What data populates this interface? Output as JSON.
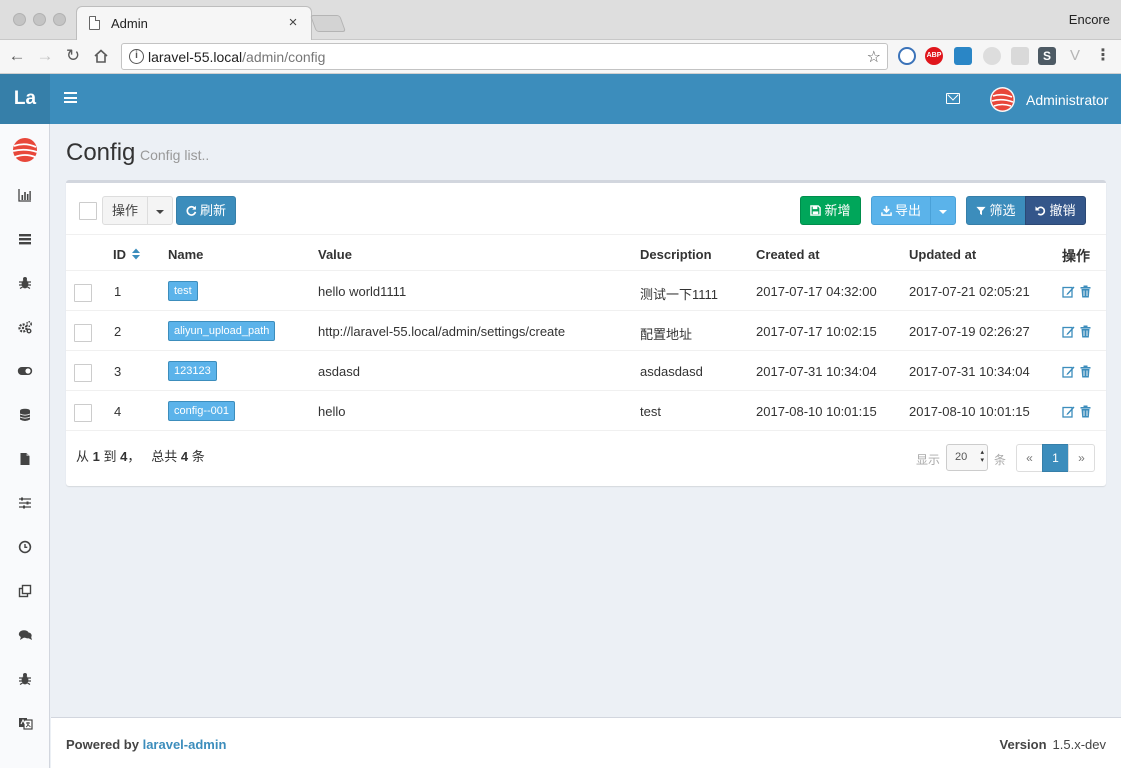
{
  "browser": {
    "tab_title": "Admin",
    "tab_close": "×",
    "profile_name": "Encore",
    "url_host": "laravel-55.local",
    "url_path": "/admin/config",
    "ext_abp": "ABP",
    "ext_s": "S",
    "ext_v": "V",
    "menu": "⋮",
    "nav_back": "←",
    "nav_forward": "→",
    "nav_reload": "↻",
    "info": "i",
    "star": "☆"
  },
  "header": {
    "logo": "La",
    "user_name": "Administrator"
  },
  "page": {
    "title": "Config",
    "subtitle": "Config list.."
  },
  "toolbar": {
    "actions_label": "操作",
    "refresh_label": "刷新",
    "create_label": "新增",
    "export_label": "导出",
    "filter_label": "筛选",
    "reset_label": "撤销"
  },
  "table": {
    "columns": [
      "ID",
      "Name",
      "Value",
      "Description",
      "Created at",
      "Updated at",
      "操作"
    ],
    "rows": [
      {
        "id": "1",
        "name": "test",
        "value": "hello world1111",
        "description": "测试一下1111",
        "created_at": "2017-07-17 04:32:00",
        "updated_at": "2017-07-21 02:05:21"
      },
      {
        "id": "2",
        "name": "aliyun_upload_path",
        "value": "http://laravel-55.local/admin/settings/create",
        "description": "配置地址",
        "created_at": "2017-07-17 10:02:15",
        "updated_at": "2017-07-19 02:26:27"
      },
      {
        "id": "3",
        "name": "123123",
        "value": "asdasd",
        "description": "asdasdasd",
        "created_at": "2017-07-31 10:34:04",
        "updated_at": "2017-07-31 10:34:04"
      },
      {
        "id": "4",
        "name": "config--001",
        "value": "hello",
        "description": "test",
        "created_at": "2017-08-10 10:01:15",
        "updated_at": "2017-08-10 10:01:15"
      }
    ]
  },
  "pagination": {
    "from_prefix": "从",
    "from": "1",
    "to_word": "到",
    "to": "4",
    "total_word": "，   总共",
    "total": "4",
    "unit": "条",
    "show_label": "显示",
    "per_page": "20",
    "per_page_unit": "条",
    "prev": "«",
    "current": "1",
    "next": "»"
  },
  "footer": {
    "powered_by": "Powered by",
    "powered_link": "laravel-admin",
    "version_label": "Version",
    "version_value": "1.5.x-dev"
  },
  "colors": {
    "header": "#3c8dbc",
    "logo_bg": "#367fa9",
    "success": "#00a65a",
    "info": "#5bb3ea"
  },
  "sidebar_icons": [
    "bar-chart-icon",
    "tasks-icon",
    "bug-icon",
    "gears-icon",
    "toggle-on-icon",
    "database-icon",
    "file-icon",
    "sliders-icon",
    "clock-icon",
    "clone-icon",
    "comments-icon",
    "bug-icon",
    "language-icon"
  ]
}
